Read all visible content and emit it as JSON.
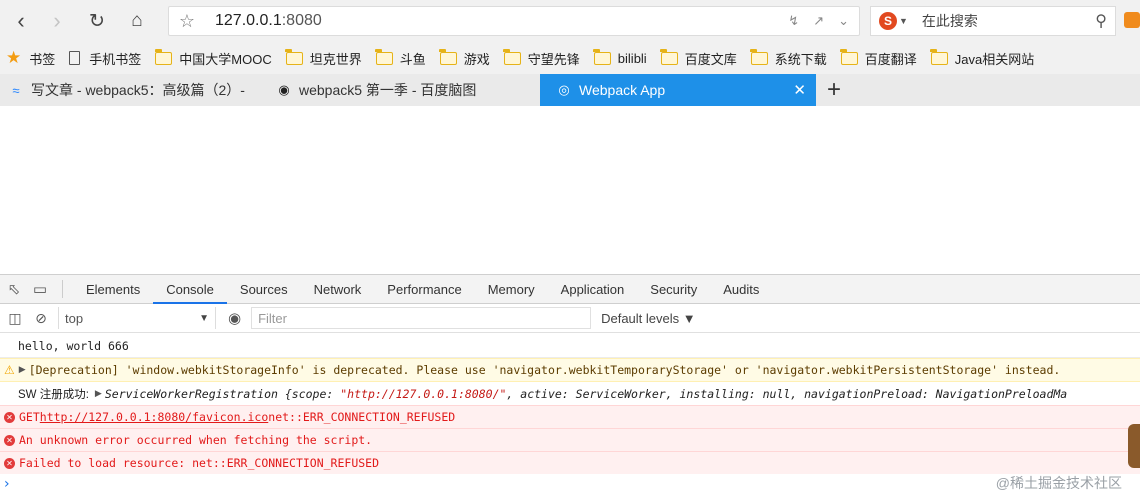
{
  "browser": {
    "url_host": "127.0.0.1",
    "url_port": ":8080",
    "search_placeholder": "在此搜索",
    "search_engine_letter": "S"
  },
  "bookmarks": [
    "书签",
    "手机书签",
    "中国大学MOOC",
    "坦克世界",
    "斗鱼",
    "游戏",
    "守望先锋",
    "bilibli",
    "百度文库",
    "系统下载",
    "百度翻译",
    "Java相关网站"
  ],
  "tabs": [
    {
      "title": "写文章 - webpack5：高级篇（2）-"
    },
    {
      "title": "webpack5 第一季 - 百度脑图"
    },
    {
      "title": "Webpack App"
    }
  ],
  "devtools": {
    "tabs": [
      "Elements",
      "Console",
      "Sources",
      "Network",
      "Performance",
      "Memory",
      "Application",
      "Security",
      "Audits"
    ],
    "active_tab": "Console",
    "context": "top",
    "filter_placeholder": "Filter",
    "levels": "Default levels ▼"
  },
  "console": {
    "log1": "hello, world 666",
    "warn1": "[Deprecation] 'window.webkitStorageInfo' is deprecated. Please use 'navigator.webkitTemporaryStorage' or 'navigator.webkitPersistentStorage' instead.",
    "sw_label": "SW 注册成功:",
    "sw_obj_name": "ServiceWorkerRegistration",
    "sw_obj_open": " {scope: ",
    "sw_scope": "\"http://127.0.0.1:8080/\"",
    "sw_obj_rest": ", active: ServiceWorker, installing: null, navigationPreload: NavigationPreloadMa",
    "err1_prefix": "GET ",
    "err1_url": "http://127.0.0.1:8080/favicon.ico",
    "err1_suffix": " net::ERR_CONNECTION_REFUSED",
    "err2": "An unknown error occurred when fetching the script.",
    "err3": "Failed to load resource: net::ERR_CONNECTION_REFUSED"
  },
  "watermark": "@稀土掘金技术社区",
  "colors": {
    "active_tab": "#1e90e8",
    "error_text": "#e21a1a",
    "warning_bg": "#fffbe5",
    "error_bg": "#fff0f0"
  }
}
